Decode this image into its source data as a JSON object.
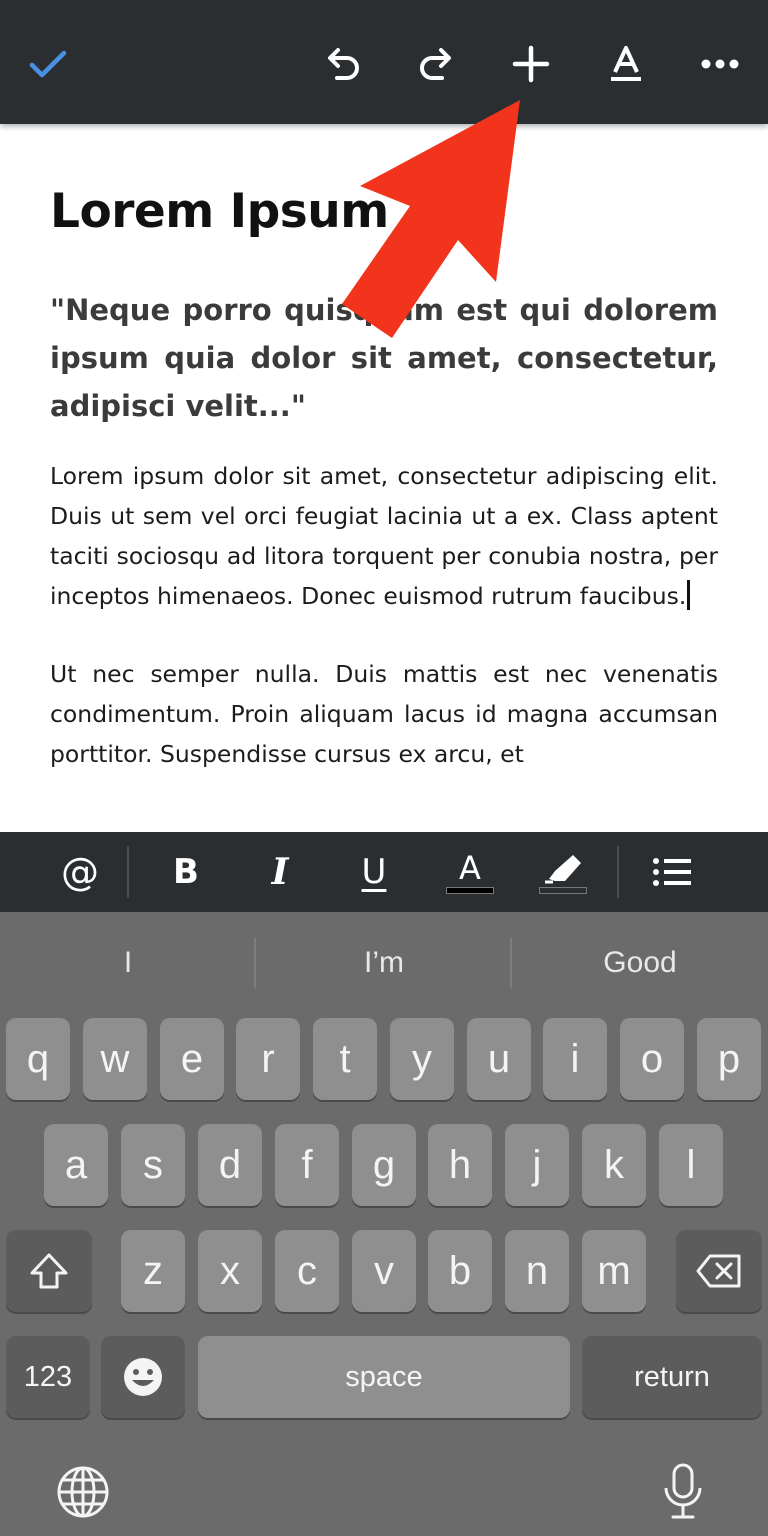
{
  "toolbar": {
    "icons": [
      "checkmark-icon",
      "undo-icon",
      "redo-icon",
      "plus-icon",
      "text-format-icon",
      "more-icon"
    ],
    "accent_color": "#4a90e2"
  },
  "document": {
    "title": "Lorem Ipsum",
    "quote": "\"Neque porro quisquam est qui dolorem ipsum quia dolor sit amet, consectetur, adipisci velit...\"",
    "paragraph1": "Lorem ipsum dolor sit amet, consectetur adipiscing elit. Duis ut sem vel orci feugiat lacinia ut a ex. Class aptent taciti sociosqu ad litora torquent per conubia nostra, per inceptos himenaeos. Donec euismod rutrum faucibus.",
    "paragraph2": "Ut nec semper nulla. Duis mattis est nec venenatis condimentum. Proin aliquam lacus id magna accumsan porttitor. Suspendisse cursus ex arcu, et"
  },
  "annotation": {
    "arrow_color": "#f2341d",
    "points_to": "plus-icon"
  },
  "format_bar": {
    "icons": [
      "mention-icon",
      "bold-icon",
      "italic-icon",
      "underline-icon",
      "text-color-icon",
      "highlight-icon",
      "list-icon"
    ],
    "mention": "@",
    "bold": "B",
    "italic": "I",
    "underline": "U",
    "text_color": "A"
  },
  "keyboard": {
    "suggestions": [
      "I",
      "I’m",
      "Good"
    ],
    "row1": [
      "q",
      "w",
      "e",
      "r",
      "t",
      "y",
      "u",
      "i",
      "o",
      "p"
    ],
    "row2": [
      "a",
      "s",
      "d",
      "f",
      "g",
      "h",
      "j",
      "k",
      "l"
    ],
    "row3": [
      "z",
      "x",
      "c",
      "v",
      "b",
      "n",
      "m"
    ],
    "numbers_key": "123",
    "space_key": "space",
    "return_key": "return",
    "icons": [
      "shift-icon",
      "backspace-icon",
      "emoji-icon",
      "globe-icon",
      "microphone-icon"
    ]
  }
}
